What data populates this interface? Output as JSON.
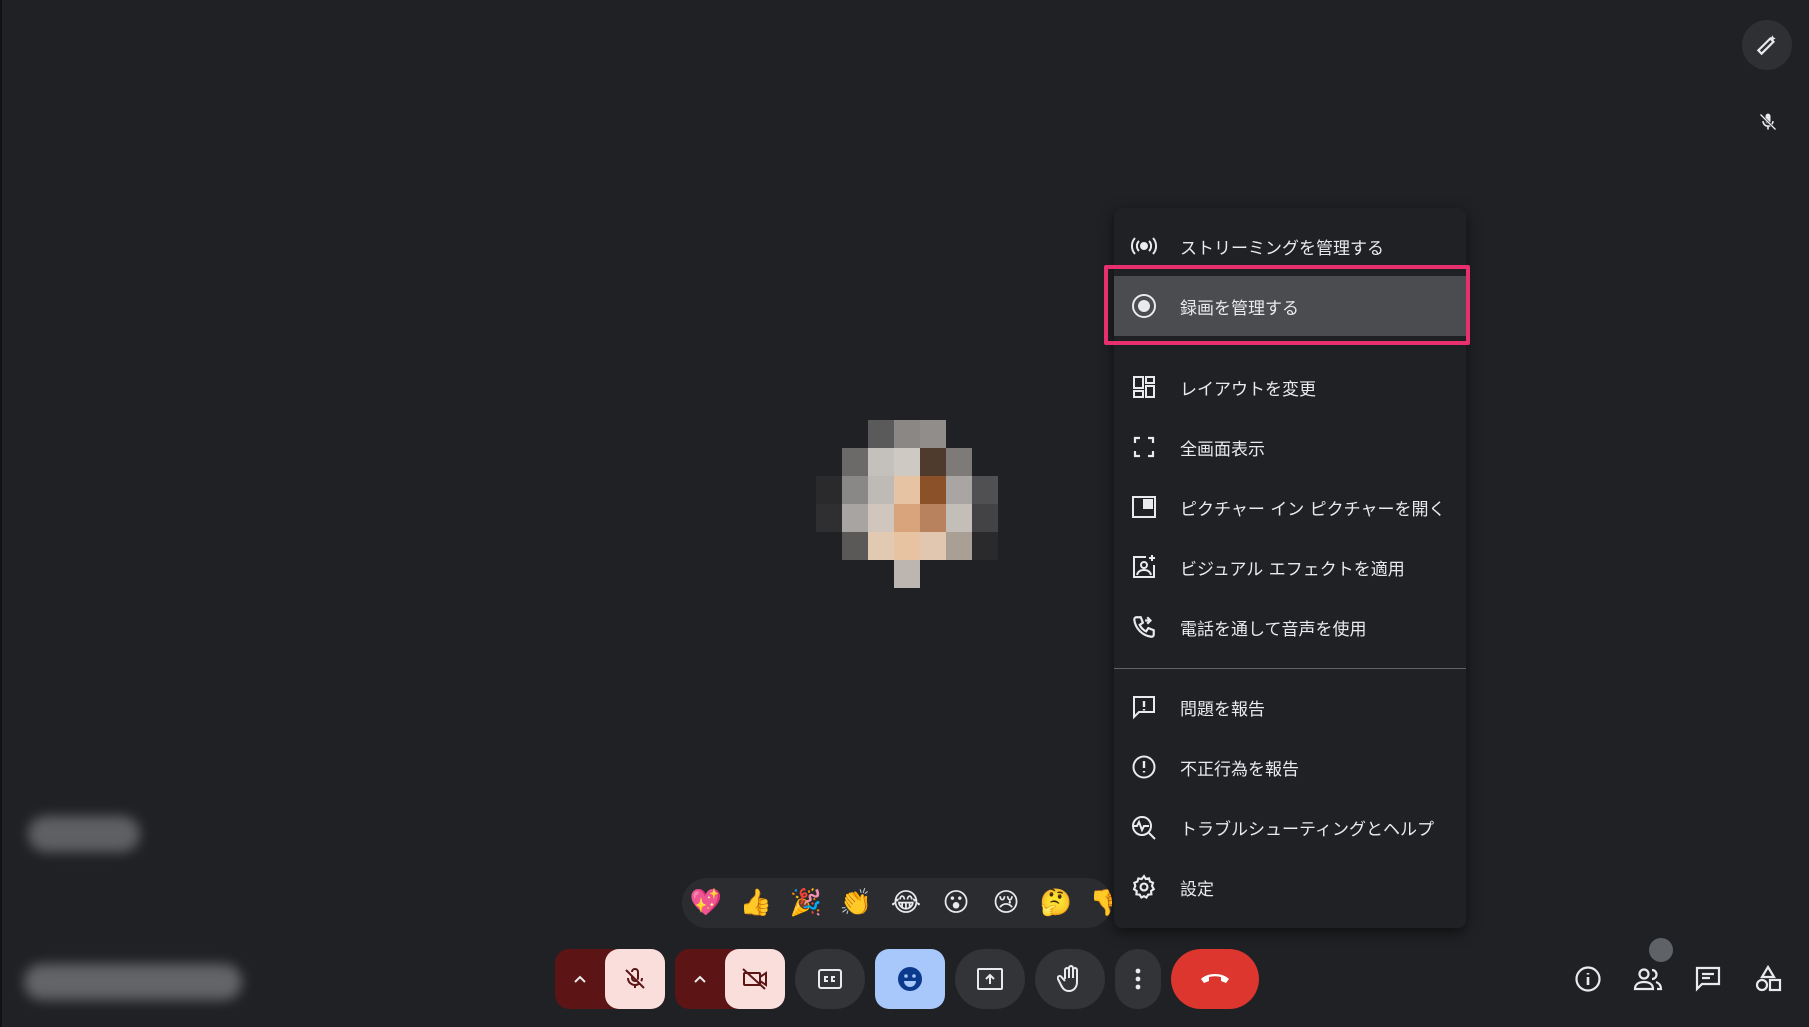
{
  "menu": {
    "items": [
      {
        "id": "streaming",
        "label": "ストリーミングを管理する",
        "icon": "broadcast-icon"
      },
      {
        "id": "recording",
        "label": "録画を管理する",
        "icon": "record-icon"
      },
      {
        "id": "layout",
        "label": "レイアウトを変更",
        "icon": "layout-icon"
      },
      {
        "id": "fullscreen",
        "label": "全画面表示",
        "icon": "fullscreen-icon"
      },
      {
        "id": "pip",
        "label": "ピクチャー イン ピクチャーを開く",
        "icon": "picture-in-picture-icon"
      },
      {
        "id": "effects",
        "label": "ビジュアル エフェクトを適用",
        "icon": "visual-effects-icon"
      },
      {
        "id": "phone",
        "label": "電話を通して音声を使用",
        "icon": "phone-forward-icon"
      },
      {
        "id": "report_problem",
        "label": "問題を報告",
        "icon": "feedback-icon"
      },
      {
        "id": "report_abuse",
        "label": "不正行為を報告",
        "icon": "alert-circle-icon"
      },
      {
        "id": "troubleshoot",
        "label": "トラブルシューティングとヘルプ",
        "icon": "troubleshoot-icon"
      },
      {
        "id": "settings",
        "label": "設定",
        "icon": "gear-icon"
      }
    ]
  },
  "reactions": [
    "💖",
    "👍",
    "🎉",
    "👏",
    "😂",
    "😮",
    "😢",
    "🤔",
    "👎"
  ],
  "controls": {
    "mic": "mic-off-icon",
    "camera": "video-off-icon",
    "captions": "closed-captions-icon",
    "emoji": "emoji-icon",
    "present": "present-screen-icon",
    "raise_hand": "hand-icon",
    "more": "more-vert-icon",
    "hangup": "call-end-icon"
  },
  "colors": {
    "background": "#202124",
    "highlight": "#e8306f",
    "hangup": "#dc362e",
    "emoji_active": "#a8c7fa",
    "muted_bg": "#5c1414"
  }
}
